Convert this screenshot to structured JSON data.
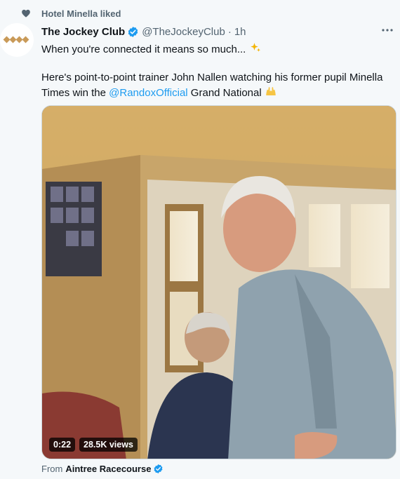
{
  "liked_by": {
    "text": "Hotel Minella liked"
  },
  "tweet": {
    "author_name": "The Jockey Club",
    "handle": "@TheJockeyClub",
    "separator": "·",
    "time": "1h",
    "line1": "When you're connected it means so much...",
    "line2_prefix": "Here's point-to-point trainer John Nallen watching his former pupil Minella Times win the ",
    "mention": "@RandoxOfficial",
    "line2_suffix": " Grand National"
  },
  "video": {
    "duration": "0:22",
    "views": "28.5K views"
  },
  "source": {
    "label": "From",
    "name": "Aintree Racecourse"
  },
  "colors": {
    "accent": "#1d9bf0",
    "muted": "#536471",
    "background": "#f5f8fa"
  }
}
